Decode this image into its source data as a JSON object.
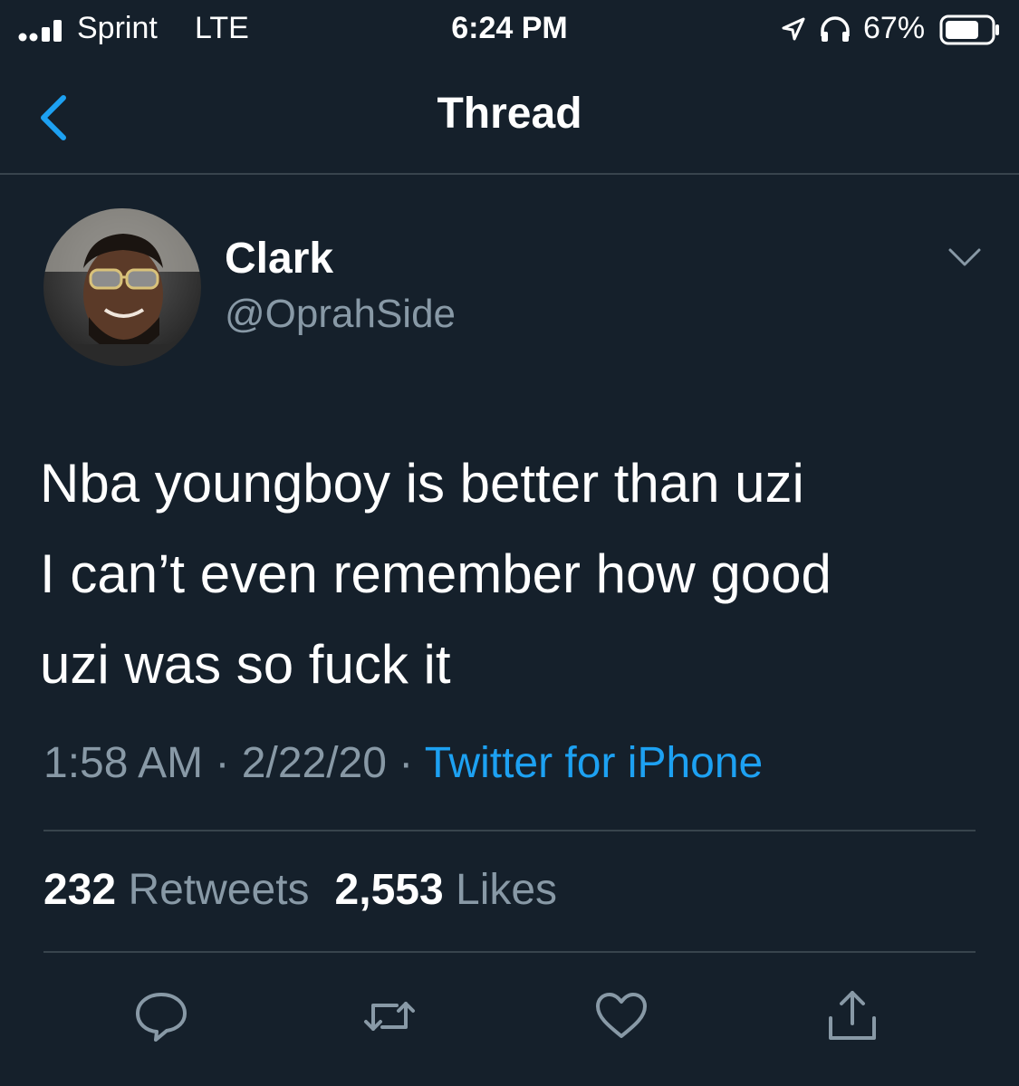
{
  "status_bar": {
    "carrier": "Sprint",
    "network": "LTE",
    "time": "6:24 PM",
    "battery_percent": "67%",
    "icons": [
      "signal-icon",
      "location-arrow-icon",
      "headphones-icon",
      "battery-icon"
    ]
  },
  "nav": {
    "title": "Thread",
    "back_icon": "chevron-left-icon"
  },
  "tweet": {
    "display_name": "Clark",
    "handle": "@OprahSide",
    "text_lines": [
      "Nba youngboy is better than uzi",
      "I can’t even remember how good",
      "uzi was so fuck it"
    ],
    "time": "1:58 AM",
    "separator": "·",
    "date": "2/22/20",
    "source": "Twitter for iPhone",
    "retweets_count": "232",
    "retweets_label": "Retweets",
    "likes_count": "2,553",
    "likes_label": "Likes"
  },
  "actions": [
    "reply-icon",
    "retweet-icon",
    "like-icon",
    "share-icon"
  ],
  "colors": {
    "background": "#15202b",
    "text": "#ffffff",
    "secondary_text": "#8899a6",
    "accent": "#1da1f2",
    "divider": "#38444d"
  }
}
